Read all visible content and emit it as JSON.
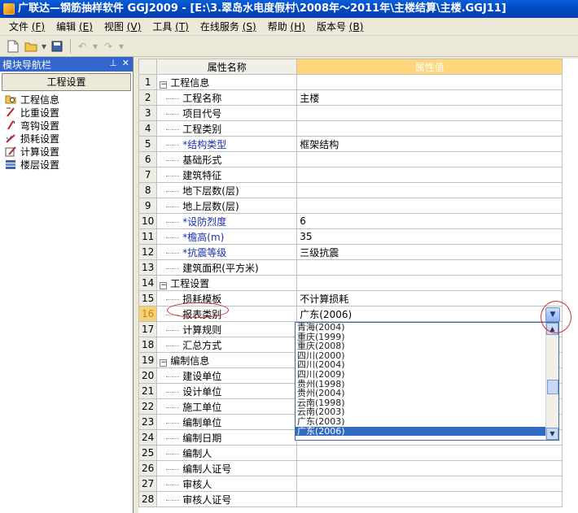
{
  "window": {
    "title": "广联达—钢筋抽样软件 GGJ2009 - [E:\\3.翠岛水电度假村\\2008年～2011年\\主楼结算\\主楼.GGJ11]"
  },
  "menu": [
    {
      "label": "文件",
      "key": "(F)"
    },
    {
      "label": "编辑",
      "key": "(E)"
    },
    {
      "label": "视图",
      "key": "(V)"
    },
    {
      "label": "工具",
      "key": "(T)"
    },
    {
      "label": "在线服务",
      "key": "(S)"
    },
    {
      "label": "帮助",
      "key": "(H)"
    },
    {
      "label": "版本号",
      "key": "(B)"
    }
  ],
  "nav": {
    "title": "模块导航栏",
    "tab": "工程设置",
    "items": [
      {
        "label": "工程信息",
        "icon": "project-info-icon"
      },
      {
        "label": "比重设置",
        "icon": "weight-settings-icon"
      },
      {
        "label": "弯钩设置",
        "icon": "hook-settings-icon"
      },
      {
        "label": "损耗设置",
        "icon": "loss-settings-icon"
      },
      {
        "label": "计算设置",
        "icon": "calc-settings-icon"
      },
      {
        "label": "楼层设置",
        "icon": "floor-settings-icon"
      }
    ]
  },
  "grid": {
    "col_name": "属性名称",
    "col_value": "属性值",
    "rows": [
      {
        "n": "1",
        "name": "工程信息",
        "value": "",
        "group": true
      },
      {
        "n": "2",
        "name": "工程名称",
        "value": "主楼"
      },
      {
        "n": "3",
        "name": "项目代号",
        "value": ""
      },
      {
        "n": "4",
        "name": "工程类别",
        "value": ""
      },
      {
        "n": "5",
        "name": "*结构类型",
        "value": "框架结构",
        "star": true
      },
      {
        "n": "6",
        "name": "基础形式",
        "value": ""
      },
      {
        "n": "7",
        "name": "建筑特征",
        "value": ""
      },
      {
        "n": "8",
        "name": "地下层数(层)",
        "value": ""
      },
      {
        "n": "9",
        "name": "地上层数(层)",
        "value": ""
      },
      {
        "n": "10",
        "name": "*设防烈度",
        "value": "6",
        "star": true
      },
      {
        "n": "11",
        "name": "*檐高(m)",
        "value": "35",
        "star": true
      },
      {
        "n": "12",
        "name": "*抗震等级",
        "value": "三级抗震",
        "star": true
      },
      {
        "n": "13",
        "name": "建筑面积(平方米)",
        "value": ""
      },
      {
        "n": "14",
        "name": "工程设置",
        "value": "",
        "group": true
      },
      {
        "n": "15",
        "name": "损耗模板",
        "value": "不计算损耗"
      },
      {
        "n": "16",
        "name": "报表类别",
        "value": "广东(2006)",
        "selected": true
      },
      {
        "n": "17",
        "name": "计算规则",
        "value": ""
      },
      {
        "n": "18",
        "name": "汇总方式",
        "value": ""
      },
      {
        "n": "19",
        "name": "编制信息",
        "value": "",
        "group": true
      },
      {
        "n": "20",
        "name": "建设单位",
        "value": ""
      },
      {
        "n": "21",
        "name": "设计单位",
        "value": ""
      },
      {
        "n": "22",
        "name": "施工单位",
        "value": ""
      },
      {
        "n": "23",
        "name": "编制单位",
        "value": ""
      },
      {
        "n": "24",
        "name": "编制日期",
        "value": ""
      },
      {
        "n": "25",
        "name": "编制人",
        "value": ""
      },
      {
        "n": "26",
        "name": "编制人证号",
        "value": ""
      },
      {
        "n": "27",
        "name": "审核人",
        "value": ""
      },
      {
        "n": "28",
        "name": "审核人证号",
        "value": ""
      }
    ]
  },
  "dropdown": {
    "options": [
      "青海(2004)",
      "重庆(1999)",
      "重庆(2008)",
      "四川(2000)",
      "四川(2004)",
      "四川(2009)",
      "贵州(1998)",
      "贵州(2004)",
      "云南(1998)",
      "云南(2003)",
      "广东(2003)",
      "广东(2006)"
    ],
    "selected_index": 11
  },
  "colors": {
    "title_bar": "#0a4fd0",
    "nav_header": "#3366cc",
    "value_header": "#ffd77a",
    "selection": "#316ac5",
    "annotation": "#d03030"
  }
}
